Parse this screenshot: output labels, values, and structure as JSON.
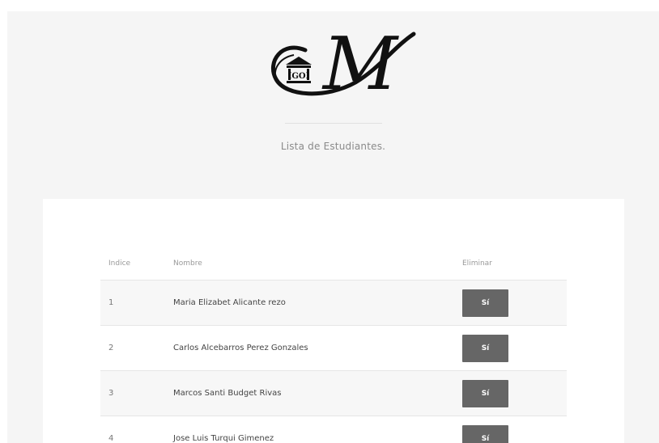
{
  "header": {
    "subtitle": "Lista de Estudiantes.",
    "logo": {
      "icon": "building-columns-icon",
      "monogram": "M",
      "emblem_text": "IGOI"
    }
  },
  "table": {
    "columns": [
      "Indice",
      "Nombre",
      "Eliminar"
    ],
    "rows": [
      {
        "index": "1",
        "name": "Maria Elizabet Alicante rezo",
        "action": "Sí"
      },
      {
        "index": "2",
        "name": "Carlos Alcebarros Perez Gonzales",
        "action": "Sí"
      },
      {
        "index": "3",
        "name": "Marcos Santi Budget Rivas",
        "action": "Sí"
      },
      {
        "index": "4",
        "name": "Jose Luis Turqui Gimenez",
        "action": "Sí"
      }
    ]
  },
  "colors": {
    "page_bg": "#f5f5f5",
    "card_bg": "#ffffff",
    "button_bg": "#666666",
    "stripe_bg": "#f7f7f7"
  }
}
